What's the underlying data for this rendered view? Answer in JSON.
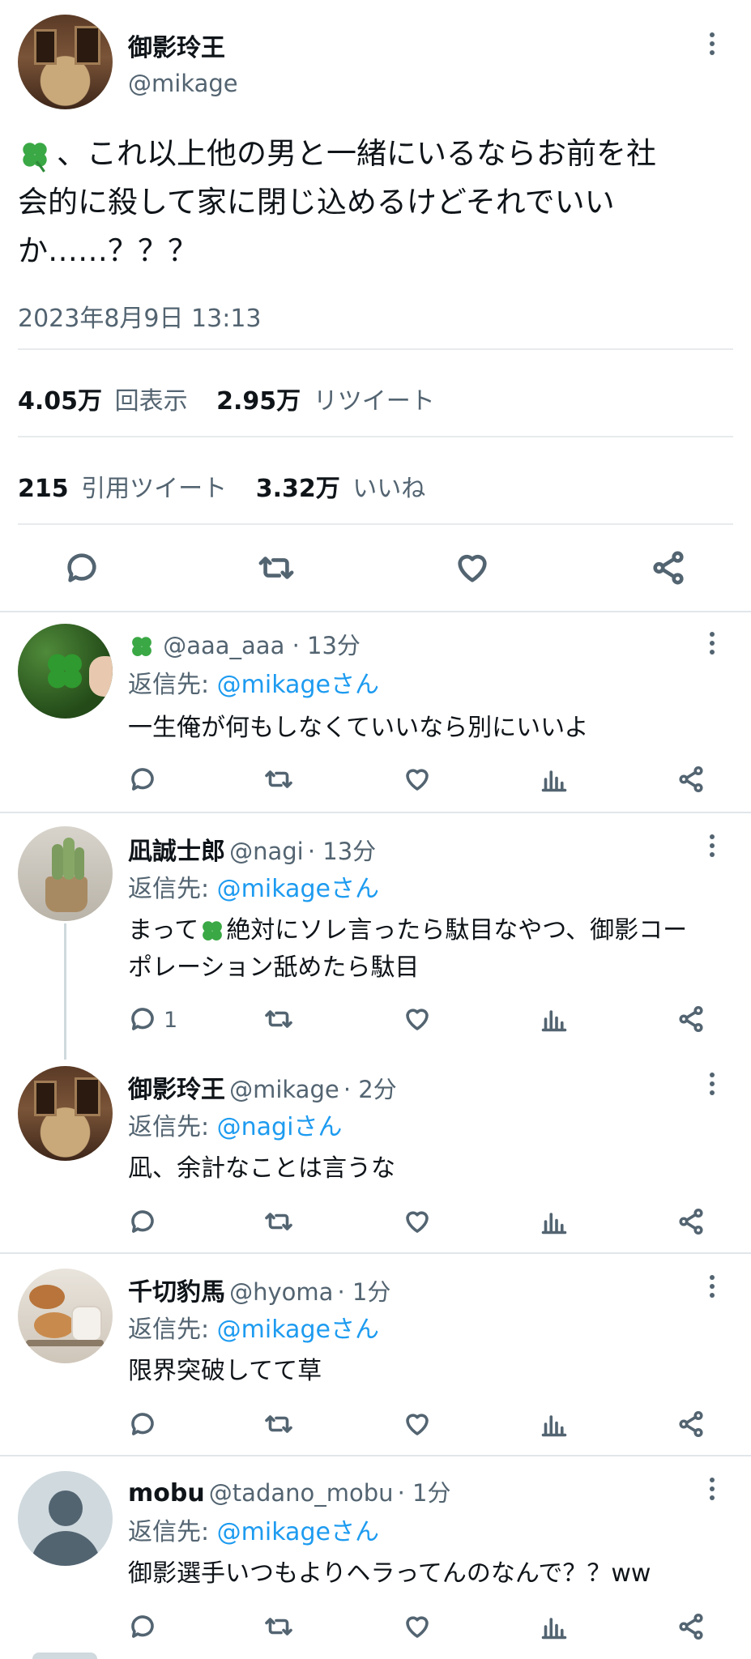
{
  "main_tweet": {
    "display_name": "御影玲王",
    "handle": "@mikage",
    "text_line1": "、これ以上他の男と一緒にいるならお前を社",
    "text_line2": "会的に殺して家に閉じ込めるけどそれでいい",
    "text_line3": "か……？？？",
    "timestamp": "2023年8月9日 13:13",
    "views_count": "4.05万",
    "views_label": "回表示",
    "retweets_count": "2.95万",
    "retweets_label": "リツイート",
    "quotes_count": "215",
    "quotes_label": "引用ツイート",
    "likes_count": "3.32万",
    "likes_label": "いいね"
  },
  "replies": [
    {
      "display_name": "",
      "handle": "@aaa_aaa",
      "time": "· 13分",
      "reply_prefix": "返信先: ",
      "reply_to": "@mikageさん",
      "text": "一生俺が何もしなくていいなら別にいいよ",
      "reply_count": ""
    },
    {
      "display_name": "凪誠士郎",
      "handle": "@nagi",
      "time": "· 13分",
      "reply_prefix": "返信先: ",
      "reply_to": "@mikageさん",
      "text_pre": "まって",
      "text_post": "絶対にソレ言ったら駄目なやつ、御影コー",
      "text_line2": "ポレーション舐めたら駄目",
      "reply_count": "1"
    },
    {
      "display_name": "御影玲王",
      "handle": "@mikage",
      "time": "· 2分",
      "reply_prefix": "返信先: ",
      "reply_to": "@nagiさん",
      "text": "凪、余計なことは言うな",
      "reply_count": ""
    },
    {
      "display_name": "千切豹馬",
      "handle": "@hyoma",
      "time": "· 1分",
      "reply_prefix": "返信先: ",
      "reply_to": "@mikageさん",
      "text": "限界突破してて草",
      "reply_count": ""
    },
    {
      "display_name": "mobu",
      "handle": "@tadano_mobu",
      "time": "· 1分",
      "reply_prefix": "返信先: ",
      "reply_to": "@mikageさん",
      "text": "御影選手いつもよりヘラってんのなんで？？ww",
      "reply_count": ""
    }
  ],
  "colors": {
    "link": "#1d9bf0",
    "muted": "#536471",
    "text": "#0f1419",
    "clover": "#3aa845"
  },
  "icons": [
    "more-icon",
    "reply-icon",
    "retweet-icon",
    "like-icon",
    "share-icon",
    "views-icon",
    "clover-icon"
  ]
}
